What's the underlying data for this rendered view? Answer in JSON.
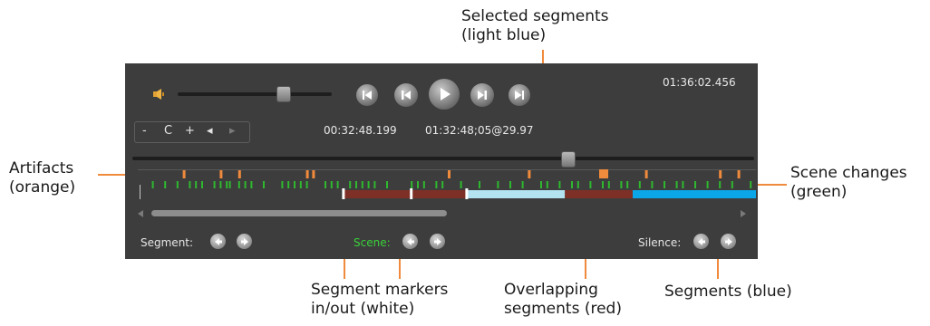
{
  "player": {
    "volume_level": 0.68,
    "position_fraction": 0.7,
    "total_time": "01:36:02.456",
    "current_time": "00:32:48.199",
    "timecode": "01:32:48;05@29.97",
    "zoom_controls": [
      "-",
      "C",
      "+",
      "◂",
      "▸"
    ],
    "transport_icons": [
      "skip-to-start-icon",
      "step-back-icon",
      "play-icon",
      "step-forward-icon",
      "skip-to-end-icon"
    ]
  },
  "timeline": {
    "artifact_color": "#f08a3c",
    "scene_color": "#2fb82f",
    "segment_color": "#0aa6e8",
    "selected_color": "#b3e2f0",
    "overlap_color": "#7e3027",
    "artifacts": [
      0.07,
      0.13,
      0.16,
      0.27,
      0.28,
      0.5,
      0.63,
      0.75,
      0.82,
      0.94,
      0.97
    ],
    "artifact_big": 0.75,
    "scene_changes": [
      0.02,
      0.04,
      0.06,
      0.08,
      0.09,
      0.1,
      0.12,
      0.13,
      0.14,
      0.145,
      0.16,
      0.17,
      0.18,
      0.2,
      0.23,
      0.24,
      0.25,
      0.26,
      0.27,
      0.3,
      0.31,
      0.32,
      0.34,
      0.35,
      0.36,
      0.37,
      0.38,
      0.4,
      0.44,
      0.45,
      0.46,
      0.48,
      0.49,
      0.52,
      0.55,
      0.58,
      0.6,
      0.62,
      0.65,
      0.66,
      0.68,
      0.7,
      0.71,
      0.73,
      0.75,
      0.76,
      0.78,
      0.79,
      0.81,
      0.83,
      0.85,
      0.87,
      0.88,
      0.9,
      0.92,
      0.94,
      0.96,
      0.99
    ],
    "segments": [
      {
        "kind": "overlap",
        "start": 0.33,
        "end": 0.44
      },
      {
        "kind": "overlap",
        "start": 0.44,
        "end": 0.53
      },
      {
        "kind": "selected",
        "start": 0.53,
        "end": 0.69
      },
      {
        "kind": "overlap",
        "start": 0.69,
        "end": 0.8
      },
      {
        "kind": "segment",
        "start": 0.8,
        "end": 1.0
      }
    ],
    "markers": [
      0.33,
      0.44,
      0.53
    ]
  },
  "nav": {
    "segment_label": "Segment:",
    "scene_label": "Scene:",
    "silence_label": "Silence:",
    "scene_label_color": "#3ad23a"
  },
  "callouts": {
    "selected": [
      "Selected segments",
      "(light blue)"
    ],
    "artifacts": [
      "Artifacts",
      "(orange)"
    ],
    "scene_changes": [
      "Scene changes",
      "(green)"
    ],
    "markers": [
      "Segment markers",
      "in/out (white)"
    ],
    "overlapping": [
      "Overlapping",
      "segments (red)"
    ],
    "segments": "Segments (blue)"
  }
}
